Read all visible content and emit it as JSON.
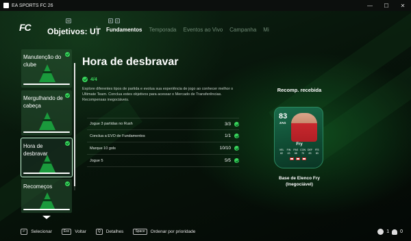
{
  "window": {
    "title": "EA SPORTS FC 26",
    "controls": [
      "—",
      "☐",
      "✕"
    ]
  },
  "header": {
    "logo": "FC",
    "title": "Objetivos: UT",
    "title_key": "W",
    "nav_keys": [
      "E",
      "C"
    ],
    "tabs": [
      {
        "label": "Fundamentos",
        "active": true
      },
      {
        "label": "Temporada",
        "active": false
      },
      {
        "label": "Eventos ao Vivo",
        "active": false
      },
      {
        "label": "Campanha",
        "active": false
      },
      {
        "label": "Mi",
        "active": false
      }
    ]
  },
  "objectives": [
    {
      "label": "Manutenção do clube",
      "completed": true,
      "selected": false
    },
    {
      "label": "Mergulhando de cabeça",
      "completed": true,
      "selected": false
    },
    {
      "label": "Hora de desbravar",
      "completed": true,
      "selected": true
    },
    {
      "label": "Recomeços",
      "completed": true,
      "selected": false
    }
  ],
  "detail": {
    "title": "Hora de desbravar",
    "progress": "4/4",
    "description": "Explore diferentes tipos de partida e evolua sua experiência de jogo ao conhecer melhor o Ultimate Team. Conclua estes objetivos para acessar o Mercado de Transferências. Recompensas inegociáveis.",
    "tasks": [
      {
        "label": "Jogue 3 partidas no Rush",
        "value": "3/3"
      },
      {
        "label": "Conclua a EVO de Fundamentos",
        "value": "1/1"
      },
      {
        "label": "Marque 10 gols",
        "value": "10/10"
      },
      {
        "label": "Jogue 5",
        "value": "5/5"
      }
    ]
  },
  "reward": {
    "heading": "Recomp. recebida",
    "card": {
      "rating": "83",
      "position": "ZAG",
      "name": "Fry",
      "stats": [
        "VEL",
        "FIN",
        "PAS",
        "CON",
        "DEF",
        "FÍS",
        "82",
        "43",
        "68",
        "70",
        "83",
        "83"
      ]
    },
    "name": "Base de Elenco Fry (Inegociável)"
  },
  "footer": {
    "hints": [
      {
        "key": "↵",
        "label": "Selecionar"
      },
      {
        "key": "Esc",
        "label": "Voltar"
      },
      {
        "key": "Q",
        "label": "Detalhes"
      },
      {
        "key": "Space",
        "label": "Ordenar por prioridade"
      }
    ],
    "status_value": "1",
    "friends_count": "0"
  }
}
